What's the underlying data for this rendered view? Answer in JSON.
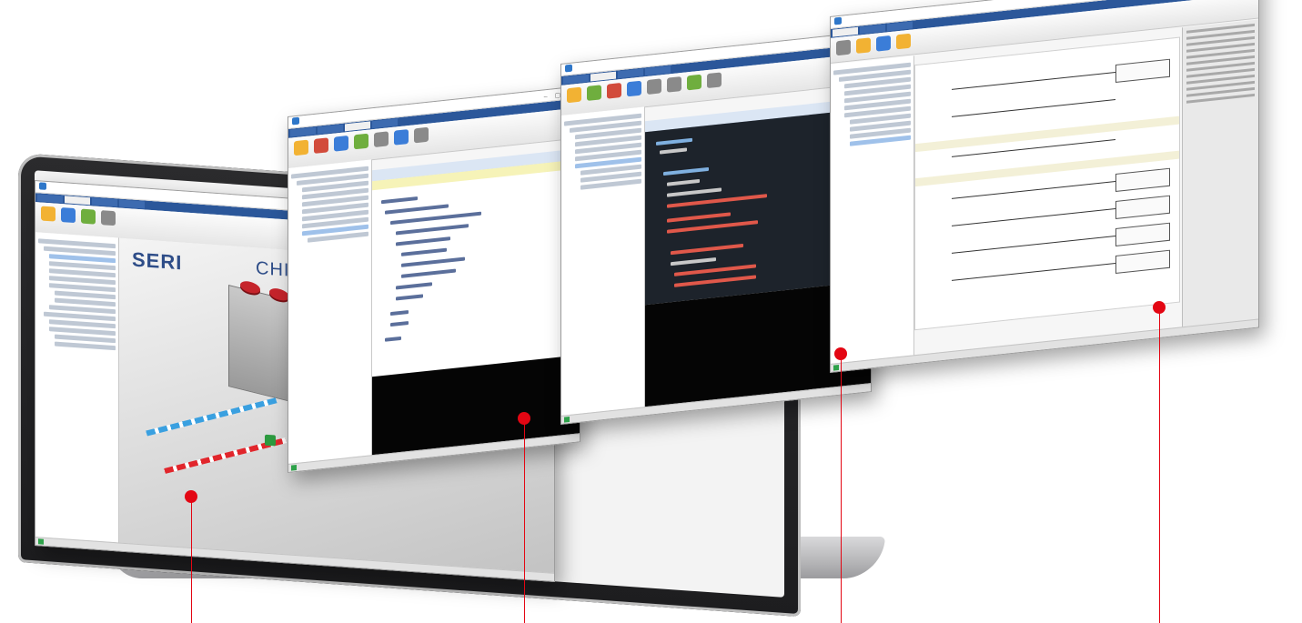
{
  "scene": {
    "logo_text": "SERI",
    "title_text": "CHILLER"
  },
  "colors": {
    "callout": "#e30613",
    "ribbon": "#2b579a",
    "dark_editor": "#1d232b",
    "brand_text": "#2e4d88"
  },
  "icons": {
    "app_logo": "app-logo-icon",
    "status": "status-indicator-icon",
    "valve": "valve-icon",
    "fan": "fan-icon"
  }
}
